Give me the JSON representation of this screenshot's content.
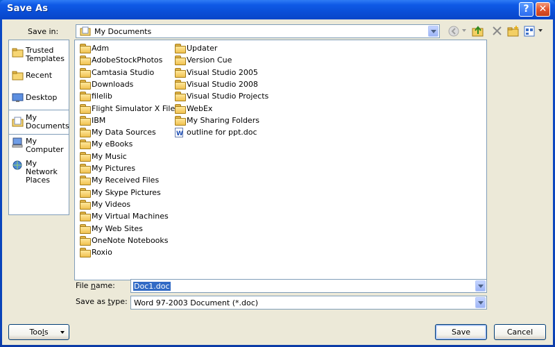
{
  "window": {
    "title": "Save As",
    "help_glyph": "?",
    "close_glyph": "✕"
  },
  "savein": {
    "label": "Save in:",
    "value": "My Documents"
  },
  "places": [
    {
      "name": "trusted-templates",
      "label": "Trusted Templates",
      "icon": "folder-icon"
    },
    {
      "name": "recent",
      "label": "Recent",
      "icon": "recent-folder-icon"
    },
    {
      "name": "desktop",
      "label": "Desktop",
      "icon": "desktop-icon"
    },
    {
      "name": "my-documents",
      "label": "My Documents",
      "icon": "documents-icon",
      "selected": true
    },
    {
      "name": "my-computer",
      "label": "My Computer",
      "icon": "computer-icon"
    },
    {
      "name": "my-network-places",
      "label": "My Network Places",
      "icon": "network-icon"
    }
  ],
  "files": {
    "col1": [
      {
        "label": "Adm",
        "icon": "folder-icon"
      },
      {
        "label": "AdobeStockPhotos",
        "icon": "folder-icon"
      },
      {
        "label": "Camtasia Studio",
        "icon": "folder-icon"
      },
      {
        "label": "Downloads",
        "icon": "folder-icon"
      },
      {
        "label": "filelib",
        "icon": "folder-icon"
      },
      {
        "label": "Flight Simulator X Files",
        "icon": "folder-icon"
      },
      {
        "label": "IBM",
        "icon": "folder-icon"
      },
      {
        "label": "My Data Sources",
        "icon": "data-sources-folder-icon"
      },
      {
        "label": "My eBooks",
        "icon": "folder-icon"
      },
      {
        "label": "My Music",
        "icon": "music-folder-icon"
      },
      {
        "label": "My Pictures",
        "icon": "pictures-folder-icon"
      },
      {
        "label": "My Received Files",
        "icon": "folder-icon"
      },
      {
        "label": "My Skype Pictures",
        "icon": "folder-icon"
      },
      {
        "label": "My Videos",
        "icon": "videos-folder-icon"
      },
      {
        "label": "My Virtual Machines",
        "icon": "folder-icon"
      },
      {
        "label": "My Web Sites",
        "icon": "web-sites-folder-icon"
      },
      {
        "label": "OneNote Notebooks",
        "icon": "folder-icon"
      },
      {
        "label": "Roxio",
        "icon": "folder-icon"
      }
    ],
    "col2": [
      {
        "label": "Updater",
        "icon": "folder-icon"
      },
      {
        "label": "Version Cue",
        "icon": "folder-icon"
      },
      {
        "label": "Visual Studio 2005",
        "icon": "folder-icon"
      },
      {
        "label": "Visual Studio 2008",
        "icon": "folder-icon"
      },
      {
        "label": "Visual Studio Projects",
        "icon": "folder-icon"
      },
      {
        "label": "WebEx",
        "icon": "folder-icon"
      },
      {
        "label": "My Sharing Folders",
        "icon": "sharing-folder-icon"
      },
      {
        "label": "outline for ppt.doc",
        "icon": "word-document-icon"
      }
    ]
  },
  "filename": {
    "label_pre": "File ",
    "label_u": "n",
    "label_post": "ame:",
    "value": "Doc1.doc"
  },
  "savetype": {
    "label_pre": "Save as ",
    "label_u": "t",
    "label_post": "ype:",
    "value": "Word 97-2003 Document (*.doc)"
  },
  "buttons": {
    "tools_pre": "Too",
    "tools_u": "l",
    "tools_post": "s",
    "save": "Save",
    "cancel": "Cancel"
  },
  "colors": {
    "title_bar": "#0a4fd8",
    "dialog_bg": "#ece9d8",
    "selection": "#316ac5"
  }
}
